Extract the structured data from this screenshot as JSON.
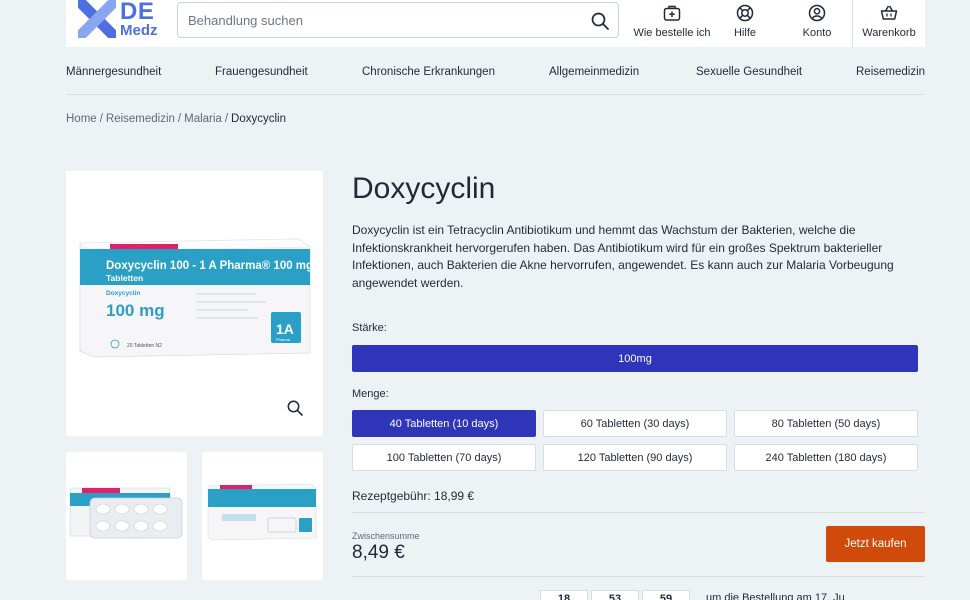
{
  "brand": {
    "logo_line1": "DE",
    "logo_line2": "Medz",
    "logo_colors": [
      "#4d6fe0",
      "#8aa6f0"
    ]
  },
  "search": {
    "placeholder": "Behandlung suchen",
    "value": ""
  },
  "header_nav": [
    {
      "label": "Wie bestelle ich",
      "icon": "medical-kit-icon"
    },
    {
      "label": "Hilfe",
      "icon": "lifebuoy-icon"
    },
    {
      "label": "Konto",
      "icon": "user-icon"
    },
    {
      "label": "Warenkorb",
      "icon": "basket-icon"
    }
  ],
  "categories": [
    "Männergesundheit",
    "Frauengesundheit",
    "Chronische Erkrankungen",
    "Allgemeinmedizin",
    "Sexuelle Gesundheit",
    "Reisemedizin"
  ],
  "breadcrumb": {
    "items": [
      "Home",
      "Reisemedizin",
      "Malaria"
    ],
    "current": "Doxycyclin",
    "separator": "/"
  },
  "product": {
    "title": "Doxycyclin",
    "description": "Doxycyclin ist ein Tetracyclin Antibiotikum und hemmt das Wachstum der Bakterien, welche die Infektionskrankheit hervorgerufen haben. Das Antibiotikum wird für ein großes Spektrum bakterieller Infektionen, auch Bakterien die Akne hervorrufen, angewendet. Es kann auch zur Malaria Vorbeugung angewendet werden.",
    "package": {
      "name": "Doxycyclin 100 - 1 A Pharma® 100 mg",
      "form": "Tabletten",
      "ingredient": "Doxycyclin",
      "strength": "100 mg",
      "count": "20 Tabletten N2",
      "brand_mark": "1A",
      "brand_sub": "Pharma"
    },
    "images": [
      "main-package-photo",
      "blister-photo",
      "package-photo"
    ]
  },
  "strength": {
    "label": "Stärke:",
    "options": [
      "100mg"
    ],
    "selected": "100mg"
  },
  "quantity": {
    "label": "Menge:",
    "options": [
      "40 Tabletten (10 days)",
      "60 Tabletten (30 days)",
      "80 Tabletten (50 days)",
      "100 Tabletten (70 days)",
      "120 Tabletten (90 days)",
      "240 Tabletten (180 days)"
    ],
    "selected": "40 Tabletten (10 days)"
  },
  "prescription_fee": "Rezeptgebühr: 18,99 €",
  "subtotal": {
    "label": "Zwischensumme",
    "value": "8,49 €"
  },
  "buy_button": "Jetzt kaufen",
  "timer": {
    "values": [
      "18",
      "53",
      "59"
    ],
    "text": "um die Bestellung am 17. Ju"
  },
  "colors": {
    "accent": "#2e35b8",
    "cta": "#cf4a0b",
    "background": "#edf3f4"
  }
}
